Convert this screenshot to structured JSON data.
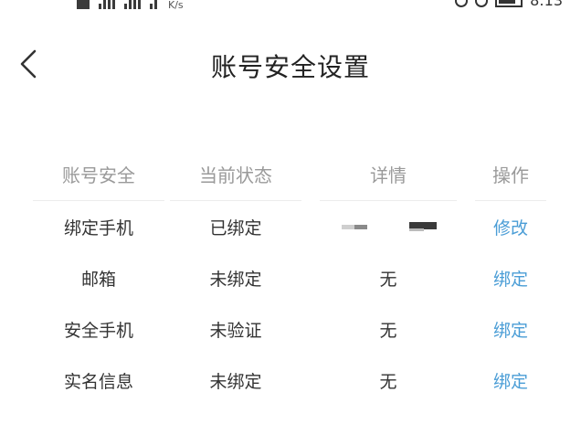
{
  "status_bar": {
    "network_speed_unit": "K/s",
    "time": "8:13"
  },
  "header": {
    "title": "账号安全设置",
    "back_icon": "chevron-left-icon"
  },
  "table": {
    "columns": [
      "账号安全",
      "当前状态",
      "详情",
      "操作"
    ],
    "rows": [
      {
        "item": "绑定手机",
        "status": "已绑定",
        "detail": "",
        "action": "修改"
      },
      {
        "item": "邮箱",
        "status": "未绑定",
        "detail": "无",
        "action": "绑定"
      },
      {
        "item": "安全手机",
        "status": "未验证",
        "detail": "无",
        "action": "绑定"
      },
      {
        "item": "实名信息",
        "status": "未绑定",
        "detail": "无",
        "action": "绑定"
      }
    ]
  },
  "colors": {
    "action_link": "#4a9dd6",
    "header_text": "#9a9a9a",
    "body_text": "#333333"
  }
}
